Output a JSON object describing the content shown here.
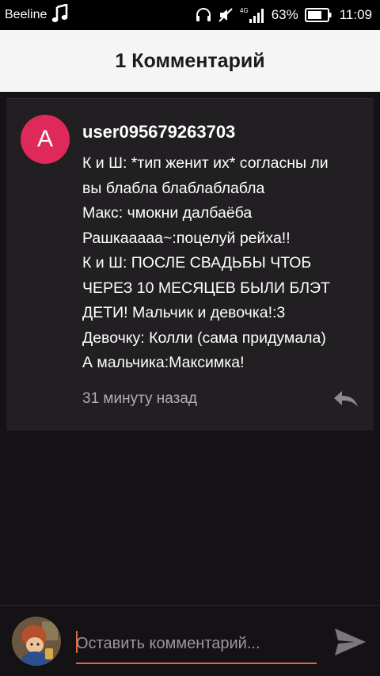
{
  "status_bar": {
    "carrier": "Beeline",
    "network": "4G",
    "battery_percent": "63%",
    "time": "11:09",
    "icons": [
      "music-note-icon",
      "headset-icon",
      "muted-icon",
      "signal-icon",
      "battery-icon"
    ]
  },
  "header": {
    "title": "1 Комментарий"
  },
  "comment": {
    "avatar_letter": "A",
    "avatar_color": "#e0295b",
    "username": "user095679263703",
    "lines": [
      "К и Ш: *тип женит их* согласны ли",
      "вы блабла блаблаблабла",
      "Макс: чмокни далбаёба",
      "Рашкааааа~:поцелуй рейха!!",
      "К и Ш: ПОСЛЕ СВАДЬБЫ ЧТОБ",
      "ЧЕРЕЗ 10 МЕСЯЦЕВ БЫЛИ БЛЭТ",
      "ДЕТИ! Мальчик и девочка!:3",
      "Девочку: Колли (сама придумала)",
      "А мальчика:Максимка!"
    ],
    "time_ago": "31 минуту назад",
    "reply_icon": "reply-icon"
  },
  "input_bar": {
    "placeholder": "Оставить комментарий...",
    "value": "",
    "accent_color": "#e8663b",
    "send_icon": "send-icon"
  }
}
